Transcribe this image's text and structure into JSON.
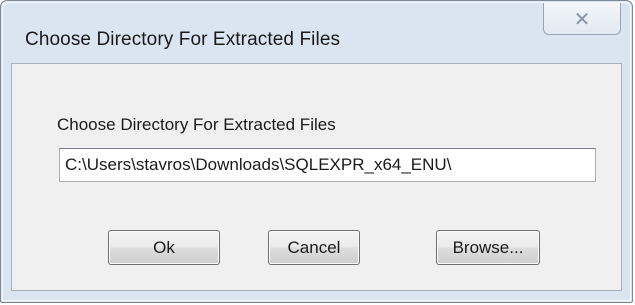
{
  "window": {
    "title": "Choose Directory For Extracted Files",
    "close_icon": "close-icon"
  },
  "form": {
    "label": "Choose Directory For Extracted Files",
    "path_value": "C:\\Users\\stavros\\Downloads\\SQLEXPR_x64_ENU\\"
  },
  "buttons": {
    "ok_label": "Ok",
    "cancel_label": "Cancel",
    "browse_label": "Browse..."
  },
  "colors": {
    "frame": "#dbe5f1",
    "client": "#f0f0f0"
  }
}
